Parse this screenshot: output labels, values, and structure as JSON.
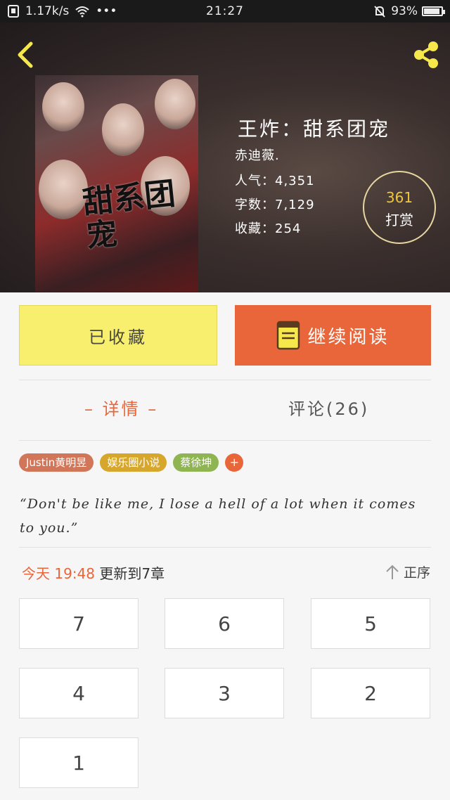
{
  "status_bar": {
    "network_speed": "1.17k/s",
    "dots": "•••",
    "time": "21:27",
    "battery": "93%",
    "battery_level": 0.93
  },
  "book": {
    "title": "王炸：甜系团宠",
    "cover_title": "甜系团宠",
    "author": "赤迪薇.",
    "popularity": "人气：4,351",
    "word_count": "字数：7,129",
    "favorites": "收藏：254"
  },
  "reward": {
    "count": "361",
    "label": "打赏"
  },
  "buttons": {
    "collected": "已收藏",
    "continue_reading": "继续阅读"
  },
  "tabs": {
    "details": "– 详情 –",
    "comments": "评论(26)"
  },
  "tags": [
    {
      "label": "Justin黄明昱",
      "color": "#d2765a"
    },
    {
      "label": "娱乐圈小说",
      "color": "#d6a72c"
    },
    {
      "label": "蔡徐坤",
      "color": "#8fb452"
    },
    {
      "label": "+",
      "color": "#e8663a"
    }
  ],
  "quote": "“Don't be like me, I lose a hell of a lot when it comes to you.”",
  "update": {
    "time": "今天 19:48",
    "text": "更新到7章"
  },
  "sort": {
    "label": "正序"
  },
  "chapters": [
    "7",
    "6",
    "5",
    "4",
    "3",
    "2",
    "1"
  ],
  "colors": {
    "accent": "#e8663a",
    "collect_bg": "#f9ef6f",
    "reward_number": "#f0c63a",
    "icon_yellow": "#f6e84a"
  },
  "icons": [
    "back-chevron-icon",
    "share-icon",
    "wifi-icon",
    "bell-muted-icon",
    "book-icon",
    "arrow-up-icon"
  ]
}
